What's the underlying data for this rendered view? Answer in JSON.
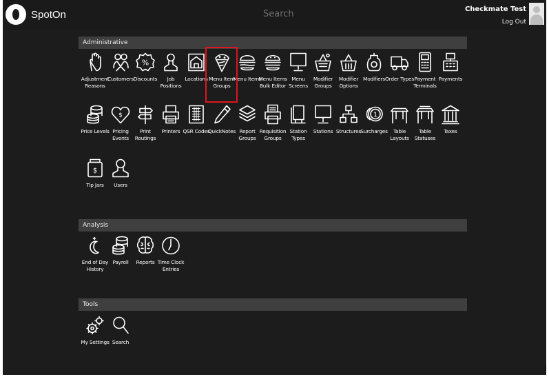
{
  "header": {
    "brand": "SpotOn",
    "search_label": "Search",
    "user_name": "Checkmate Test",
    "logout_label": "Log Out"
  },
  "sections": {
    "administrative": {
      "title": "Administrative",
      "items": [
        {
          "label": "Adjustment\nReasons",
          "icon": "hand-icon"
        },
        {
          "label": "Customers",
          "icon": "customers-icon"
        },
        {
          "label": "Discounts",
          "icon": "discount-icon"
        },
        {
          "label": "Job\nPositions",
          "icon": "person-icon"
        },
        {
          "label": "Locations",
          "icon": "building-icon"
        },
        {
          "label": "Menu Item\nGroups",
          "icon": "menu-item-groups-icon"
        },
        {
          "label": "Menu Items",
          "icon": "burger-icon"
        },
        {
          "label": "Menu Items\nBulk Editor",
          "icon": "burger-edit-icon"
        },
        {
          "label": "Menu\nScreens",
          "icon": "monitor-icon"
        },
        {
          "label": "Modifier\nGroups",
          "icon": "basket-icon"
        },
        {
          "label": "Modifier\nOptions",
          "icon": "basket-options-icon"
        },
        {
          "label": "Modifiers",
          "icon": "jar-icon"
        },
        {
          "label": "Order Types",
          "icon": "delivery-truck-icon"
        },
        {
          "label": "Payment\nTerminals",
          "icon": "terminal-icon"
        },
        {
          "label": "Payments",
          "icon": "register-icon"
        },
        {
          "label": "Price Levels",
          "icon": "coins-icon"
        },
        {
          "label": "Pricing\nEvents",
          "icon": "heart-tag-icon"
        },
        {
          "label": "Print\nRoutings",
          "icon": "signpost-icon"
        },
        {
          "label": "Printers",
          "icon": "printer-icon"
        },
        {
          "label": "QSR Codes",
          "icon": "keypad-icon"
        },
        {
          "label": "QuickNotes",
          "icon": "pen-icon"
        },
        {
          "label": "Report\nGroups",
          "icon": "stack-icon"
        },
        {
          "label": "Requisition\nGroups",
          "icon": "printer-doc-icon"
        },
        {
          "label": "Station\nTypes",
          "icon": "kiosk-icon"
        },
        {
          "label": "Stations",
          "icon": "monitor-stand-icon"
        },
        {
          "label": "Structures",
          "icon": "org-chart-icon"
        },
        {
          "label": "Surcharges",
          "icon": "coin-icon"
        },
        {
          "label": "Table\nLayouts",
          "icon": "table-icon"
        },
        {
          "label": "Table\nStatuses",
          "icon": "table-status-icon"
        },
        {
          "label": "Taxes",
          "icon": "government-icon"
        },
        {
          "label": "Tip Jars",
          "icon": "tip-jar-icon"
        },
        {
          "label": "Users",
          "icon": "user-icon"
        }
      ]
    },
    "analysis": {
      "title": "Analysis",
      "items": [
        {
          "label": "End of Day\nHistory",
          "icon": "night-icon"
        },
        {
          "label": "Payroll",
          "icon": "coins-icon"
        },
        {
          "label": "Reports",
          "icon": "brain-icon"
        },
        {
          "label": "Time Clock\nEntries",
          "icon": "clock-icon"
        }
      ]
    },
    "tools": {
      "title": "Tools",
      "items": [
        {
          "label": "My Settings",
          "icon": "gears-icon"
        },
        {
          "label": "Search",
          "icon": "search-icon"
        }
      ]
    }
  },
  "selected_item": "Menu Item\nGroups",
  "colors": {
    "background": "#1c1c1c",
    "section_header": "#3f3f3f",
    "highlight": "#e0141e"
  }
}
